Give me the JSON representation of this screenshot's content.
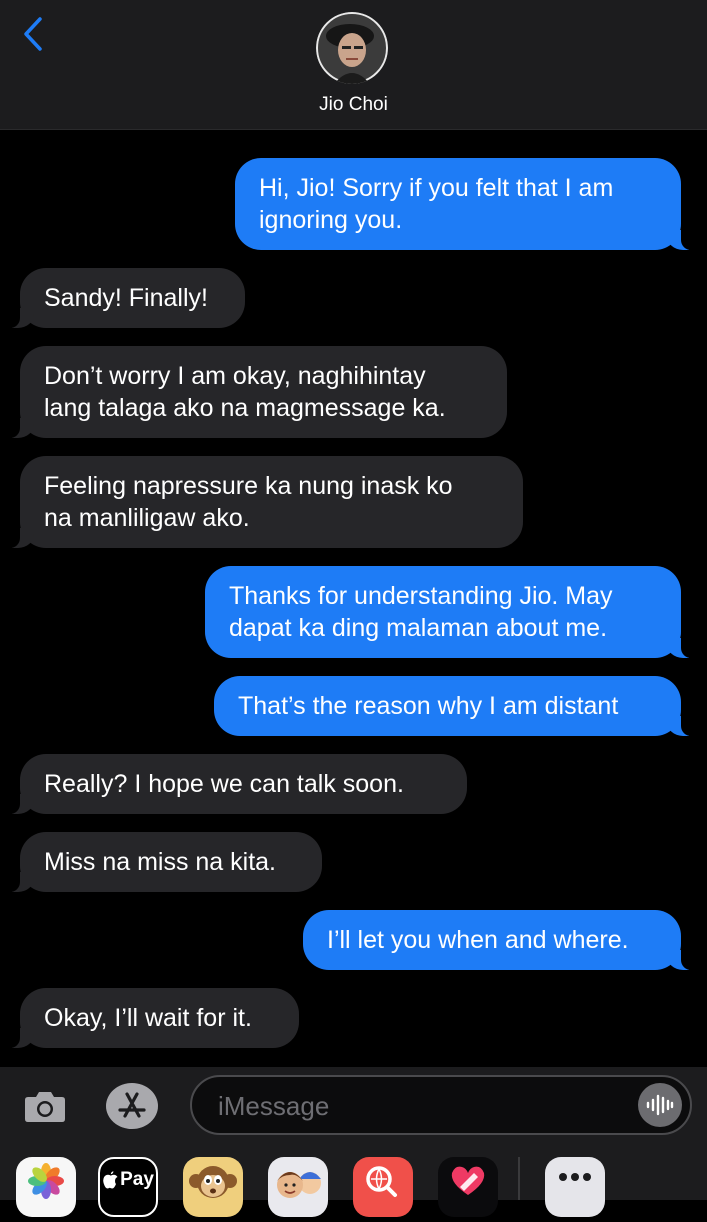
{
  "header": {
    "contact_name": "Jio Choi",
    "back_icon": "chevron-left-icon",
    "avatar": "contact-avatar"
  },
  "messages": [
    {
      "side": "out",
      "text": "Hi, Jio! Sorry if you felt that I am\nignoring you."
    },
    {
      "side": "in",
      "text": "Sandy! Finally!"
    },
    {
      "side": "in",
      "text": "Don’t worry I am okay, naghihintay\nlang talaga ako na magmessage ka."
    },
    {
      "side": "in",
      "text": "Feeling napressure ka nung inask ko\nna manliligaw ako."
    },
    {
      "side": "out",
      "text": "Thanks for understanding Jio. May\ndapat ka ding malaman about me."
    },
    {
      "side": "out",
      "text": "That’s the reason why I am distant"
    },
    {
      "side": "in",
      "text": "Really? I hope we can talk soon."
    },
    {
      "side": "in",
      "text": "Miss na miss na kita."
    },
    {
      "side": "out",
      "text": "I’ll let you when and where."
    },
    {
      "side": "in",
      "text": "Okay, I’ll wait for it."
    }
  ],
  "input": {
    "placeholder": "iMessage",
    "camera_icon": "camera-icon",
    "appstore_icon": "app-store-icon",
    "audio_icon": "audio-waveform-icon"
  },
  "app_drawer": {
    "apple_pay_label": "Pay",
    "apps": [
      "photos-app-icon",
      "apple-pay-icon",
      "animoji-icon",
      "memoji-icon",
      "web-search-icon",
      "digital-touch-icon",
      "more-apps-icon"
    ]
  },
  "colors": {
    "outgoing_bubble": "#1e7cf6",
    "incoming_bubble": "#262629",
    "header_bg": "#1c1c1e",
    "accent": "#1e7cf6"
  }
}
